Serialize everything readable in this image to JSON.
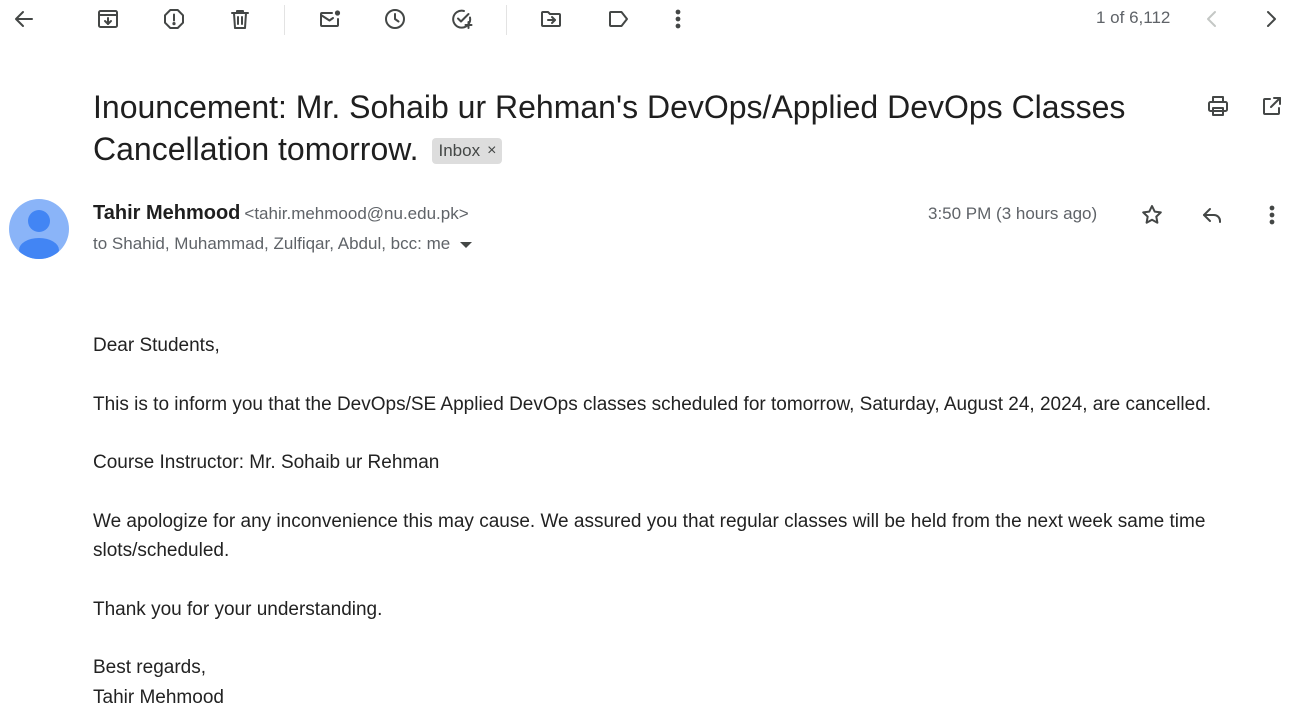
{
  "toolbar": {
    "icons": {
      "back": "arrow-left-icon",
      "archive": "archive-icon",
      "spam": "report-spam-icon",
      "delete": "trash-icon",
      "mark_unread": "mark-unread-icon",
      "snooze": "clock-icon",
      "add_task": "add-task-icon",
      "move_to": "move-to-folder-icon",
      "labels": "label-icon",
      "more": "more-vertical-icon",
      "prev": "chevron-left-icon",
      "next": "chevron-right-icon"
    },
    "counter": "1 of 6,112"
  },
  "message": {
    "subject": "Inouncement: Mr. Sohaib ur Rehman's DevOps/Applied DevOps Classes Cancellation tomorrow.",
    "label": "Inbox",
    "label_remove": "×",
    "sender_name": "Tahir Mehmood",
    "sender_email": "<tahir.mehmood@nu.edu.pk>",
    "recipients": "to Shahid, Muhammad, Zulfiqar, Abdul, bcc: me",
    "timestamp": "3:50 PM (3 hours ago)",
    "body": {
      "greeting": "Dear Students,",
      "p1": "This is to inform you that the DevOps/SE Applied DevOps classes scheduled for tomorrow, Saturday, August 24, 2024, are cancelled.",
      "p2": "Course Instructor: Mr. Sohaib ur Rehman",
      "p3": "We apologize for any inconvenience this may cause. We assured you that regular classes will be held from the next week same time slots/scheduled.",
      "p4": "Thank you for your understanding.",
      "closing": "Best regards,",
      "signature": "Tahir Mehmood"
    }
  },
  "colors": {
    "avatar_bg": "#8ab4f8",
    "avatar_fg": "#4285f4",
    "icon": "#444746",
    "secondary_text": "#5f6368",
    "chip_bg": "#dddddd"
  }
}
